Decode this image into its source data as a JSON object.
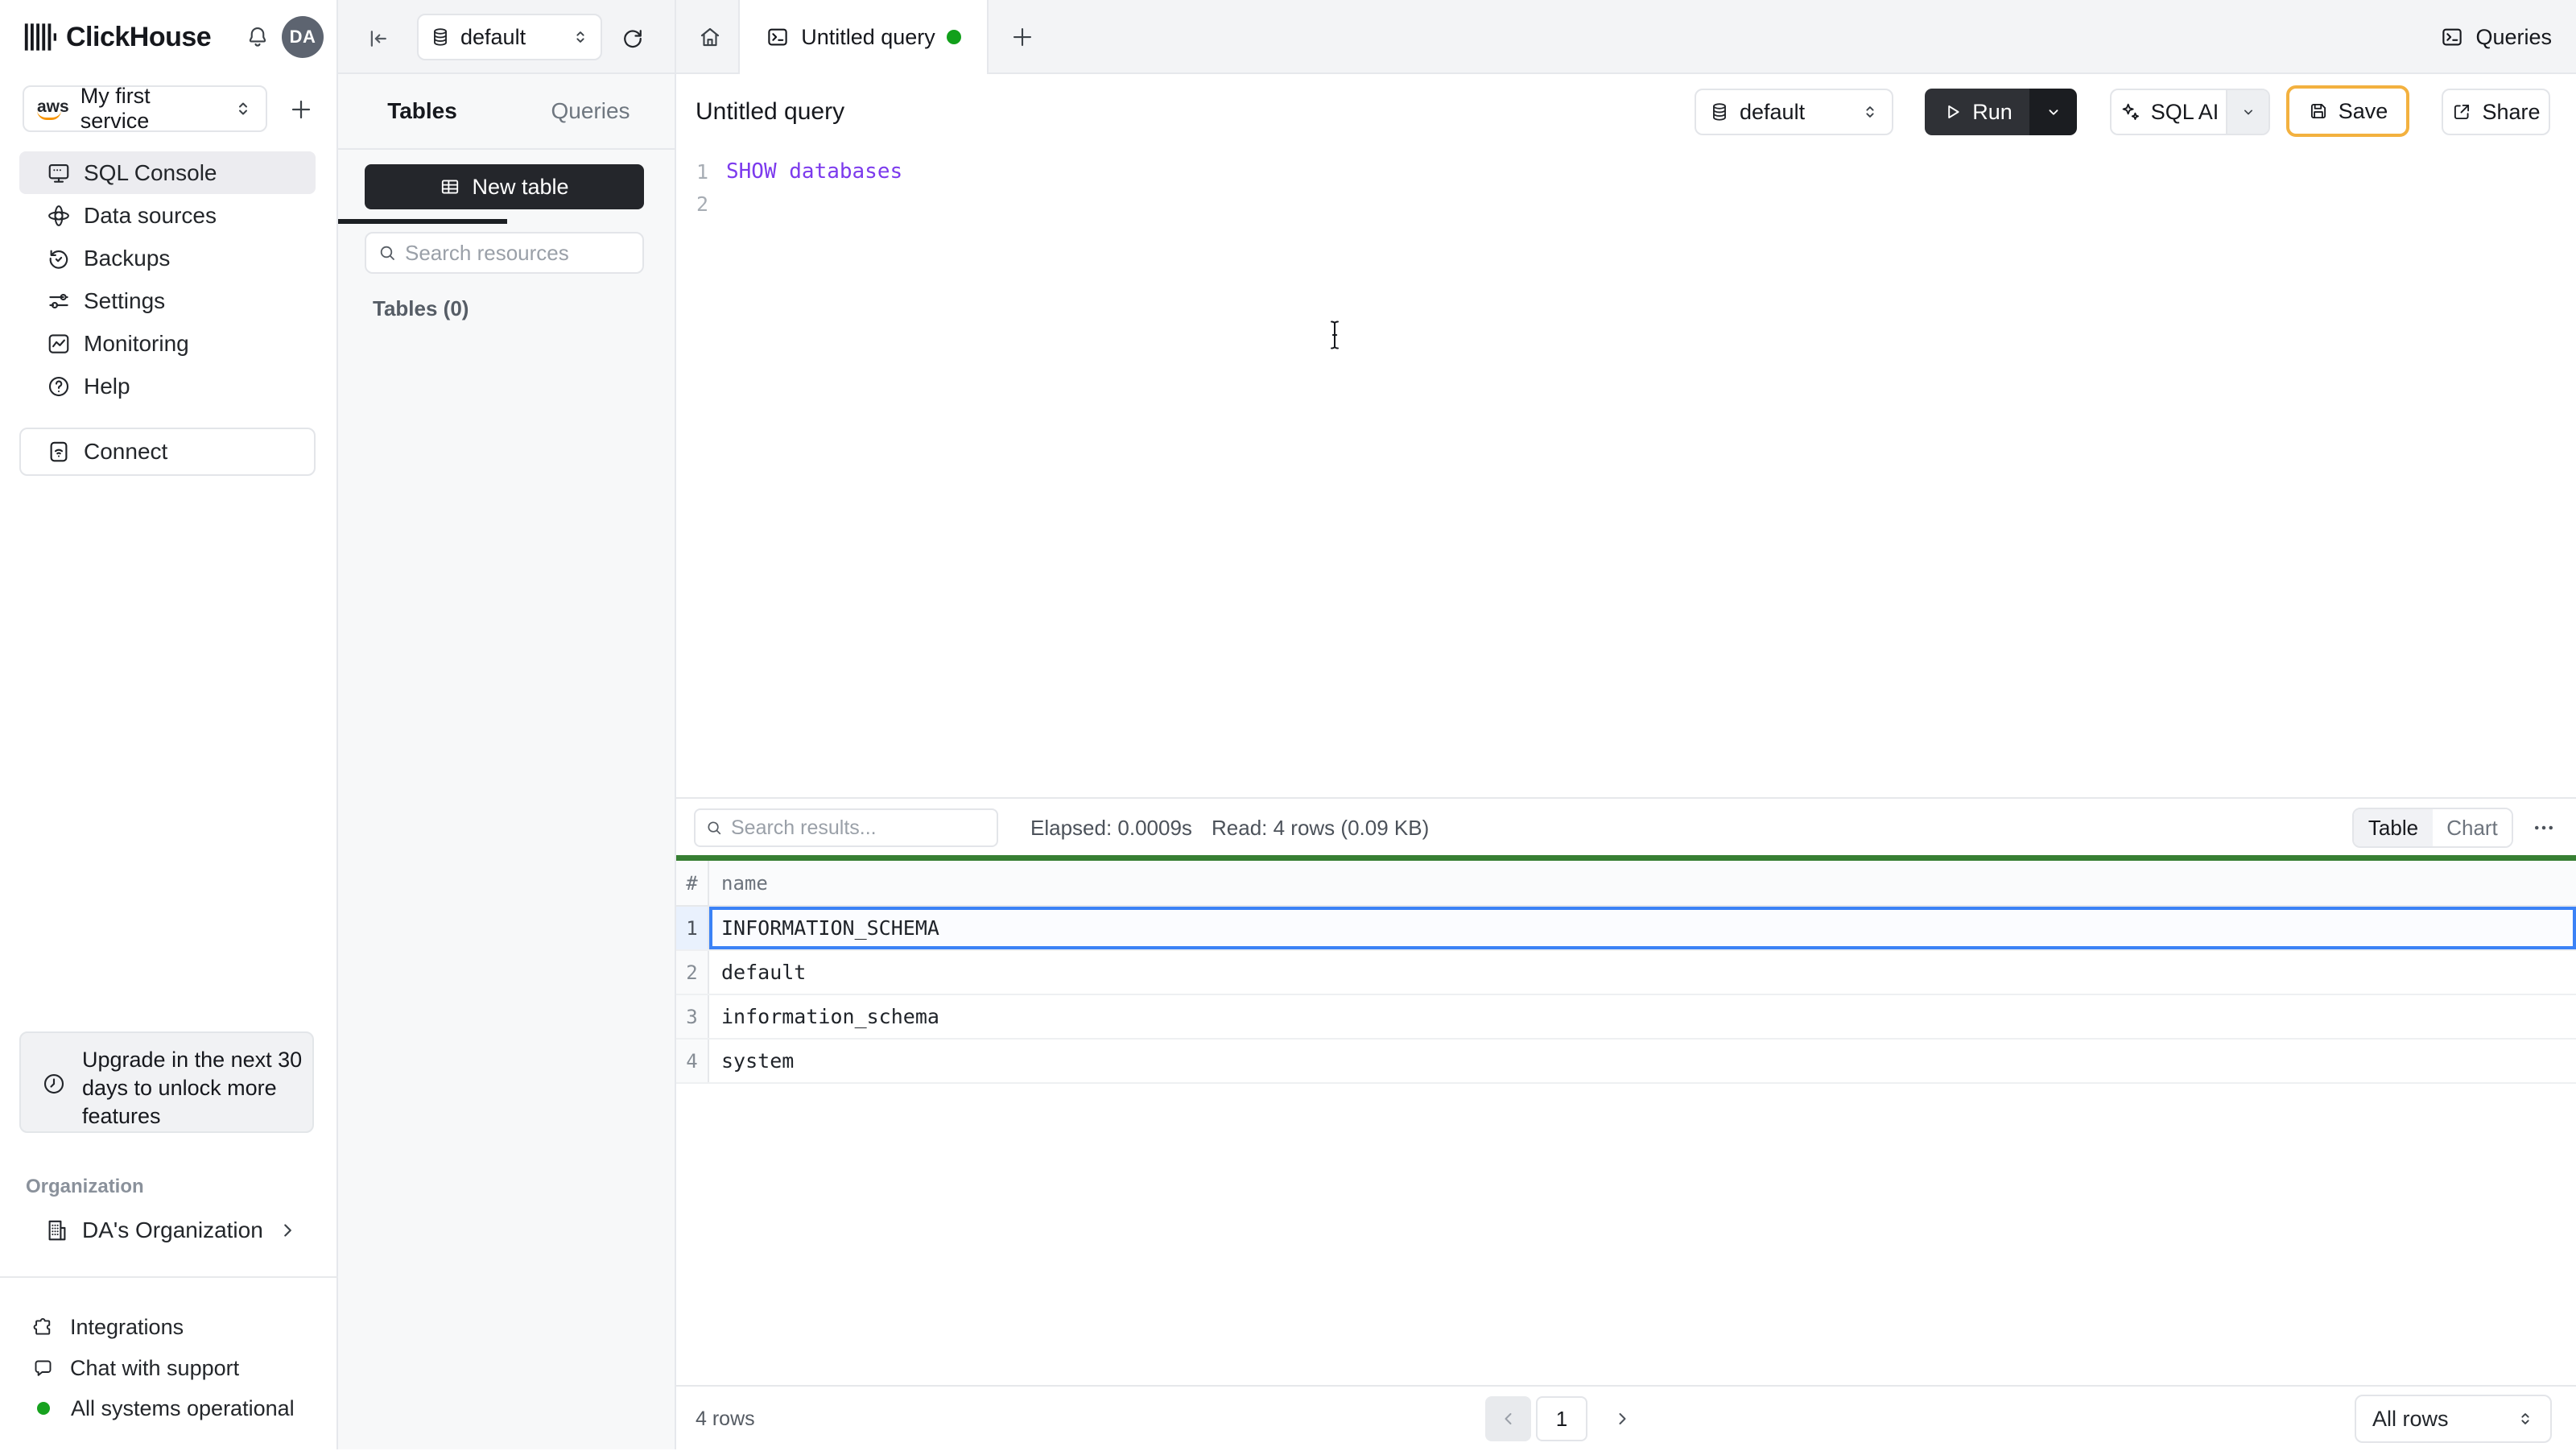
{
  "header": {
    "brand": "ClickHouse",
    "avatar_initials": "DA"
  },
  "sidebar": {
    "service_selector": {
      "provider": "aws",
      "label": "My first service"
    },
    "nav": [
      {
        "label": "SQL Console",
        "active": true
      },
      {
        "label": "Data sources"
      },
      {
        "label": "Backups"
      },
      {
        "label": "Settings"
      },
      {
        "label": "Monitoring"
      },
      {
        "label": "Help"
      }
    ],
    "connect_label": "Connect",
    "upgrade_notice": "Upgrade in the next 30 days to unlock more features",
    "organization": {
      "section_label": "Organization",
      "name": "DA's Organization"
    },
    "footer": {
      "integrations": "Integrations",
      "chat": "Chat with support",
      "status": "All systems operational"
    }
  },
  "explorer": {
    "database_selector": "default",
    "tabs": {
      "tables": "Tables",
      "queries": "Queries"
    },
    "new_table_label": "New table",
    "search_placeholder": "Search resources",
    "section_label": "Tables (0)"
  },
  "workspace": {
    "tab_title": "Untitled query",
    "queries_button": "Queries",
    "query_title": "Untitled query",
    "database_selector": "default",
    "run_label": "Run",
    "sql_ai_label": "SQL AI",
    "save_label": "Save",
    "share_label": "Share",
    "editor": {
      "lines": [
        {
          "number": "1",
          "code": "SHOW databases"
        },
        {
          "number": "2",
          "code": ""
        }
      ]
    }
  },
  "results": {
    "search_placeholder": "Search results...",
    "elapsed": "Elapsed: 0.0009s",
    "read": "Read: 4 rows (0.09 KB)",
    "view_toggle": {
      "table": "Table",
      "chart": "Chart",
      "active": "Table"
    },
    "table": {
      "columns": [
        "#",
        "name"
      ],
      "row_numbers": [
        "1",
        "2",
        "3",
        "4"
      ],
      "rows": [
        "INFORMATION_SCHEMA",
        "default",
        "information_schema",
        "system"
      ],
      "selected_row_index": 0
    },
    "footer": {
      "row_count": "4 rows",
      "page": "1",
      "page_size": "All rows"
    }
  },
  "colors": {
    "accent_green_bar": "#377f33",
    "status_green": "#17a21f",
    "tab_dot_green": "#12a01b",
    "selection_blue": "#3b82f6",
    "save_highlight": "#f3b13f",
    "sql_keyword_purple": "#7c3aed",
    "dark_button": "#2f3136",
    "aws_orange": "#f79400"
  }
}
